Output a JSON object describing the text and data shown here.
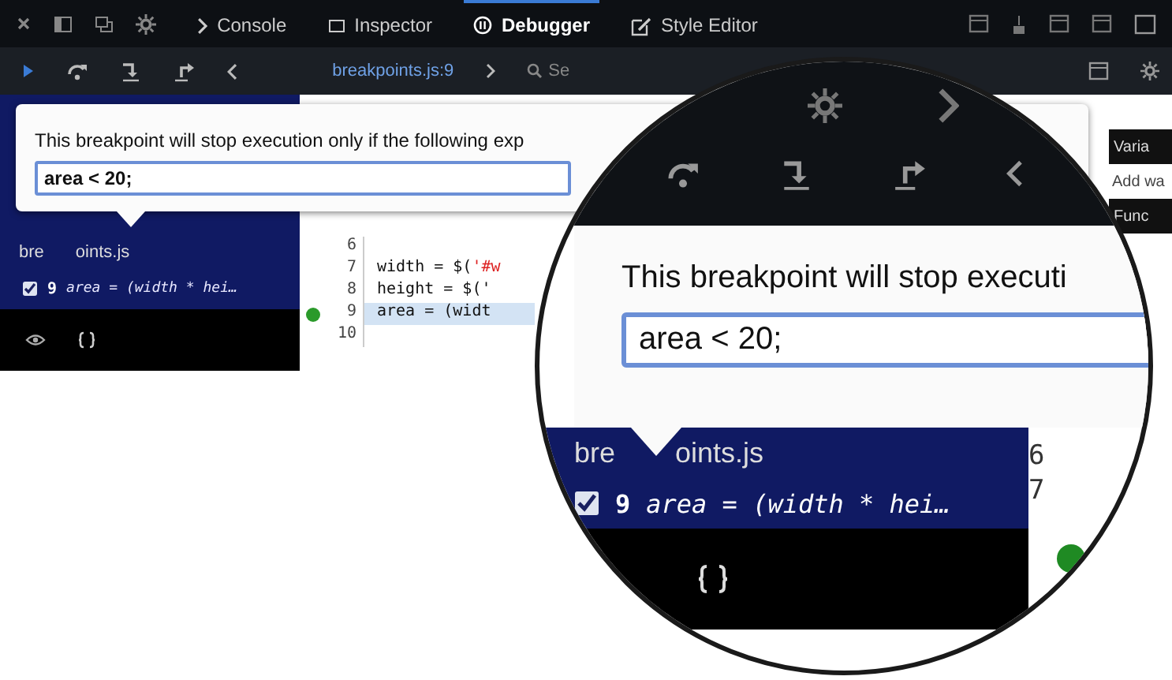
{
  "toolbar": {
    "tabs": [
      {
        "label": "Console",
        "selected": false
      },
      {
        "label": "Inspector",
        "selected": false
      },
      {
        "label": "Debugger",
        "selected": true
      },
      {
        "label": "Style Editor",
        "selected": false
      }
    ]
  },
  "debugger_bar": {
    "breadcrumb": "breakpoints.js:9",
    "search": {
      "placeholder": "Se"
    }
  },
  "condition_popup": {
    "message": "This breakpoint will stop execution only if the following exp",
    "value": "area < 20;"
  },
  "sources": {
    "file_name_parts": [
      "bre",
      "oints.js"
    ],
    "breakpoints": [
      {
        "checked": true,
        "line": "9",
        "text": "area = (width * hei…"
      }
    ]
  },
  "editor": {
    "lines": [
      {
        "number": "6",
        "breakpoint": false,
        "highlighted": false
      },
      {
        "number": "7",
        "code": "width = $(",
        "string": "'#w",
        "breakpoint": false,
        "highlighted": false
      },
      {
        "number": "8",
        "code": "height = $('",
        "breakpoint": false,
        "highlighted": false
      },
      {
        "number": "9",
        "code": "area = (widt",
        "breakpoint": true,
        "highlighted": true
      },
      {
        "number": "10",
        "breakpoint": false,
        "highlighted": false
      }
    ]
  },
  "variables_panel": {
    "header": "Varia",
    "watch_placeholder": "Add wa",
    "scope": "Func"
  },
  "magnifier": {
    "message": "This breakpoint will stop executi",
    "value": "area < 20;",
    "file_name_parts": [
      "bre",
      "oints.js"
    ],
    "breakpoint": {
      "checked": true,
      "line": "9",
      "text": "area = (width * hei…"
    },
    "line_numbers": [
      "6",
      "7"
    ],
    "breakpoint_dot": true
  }
}
